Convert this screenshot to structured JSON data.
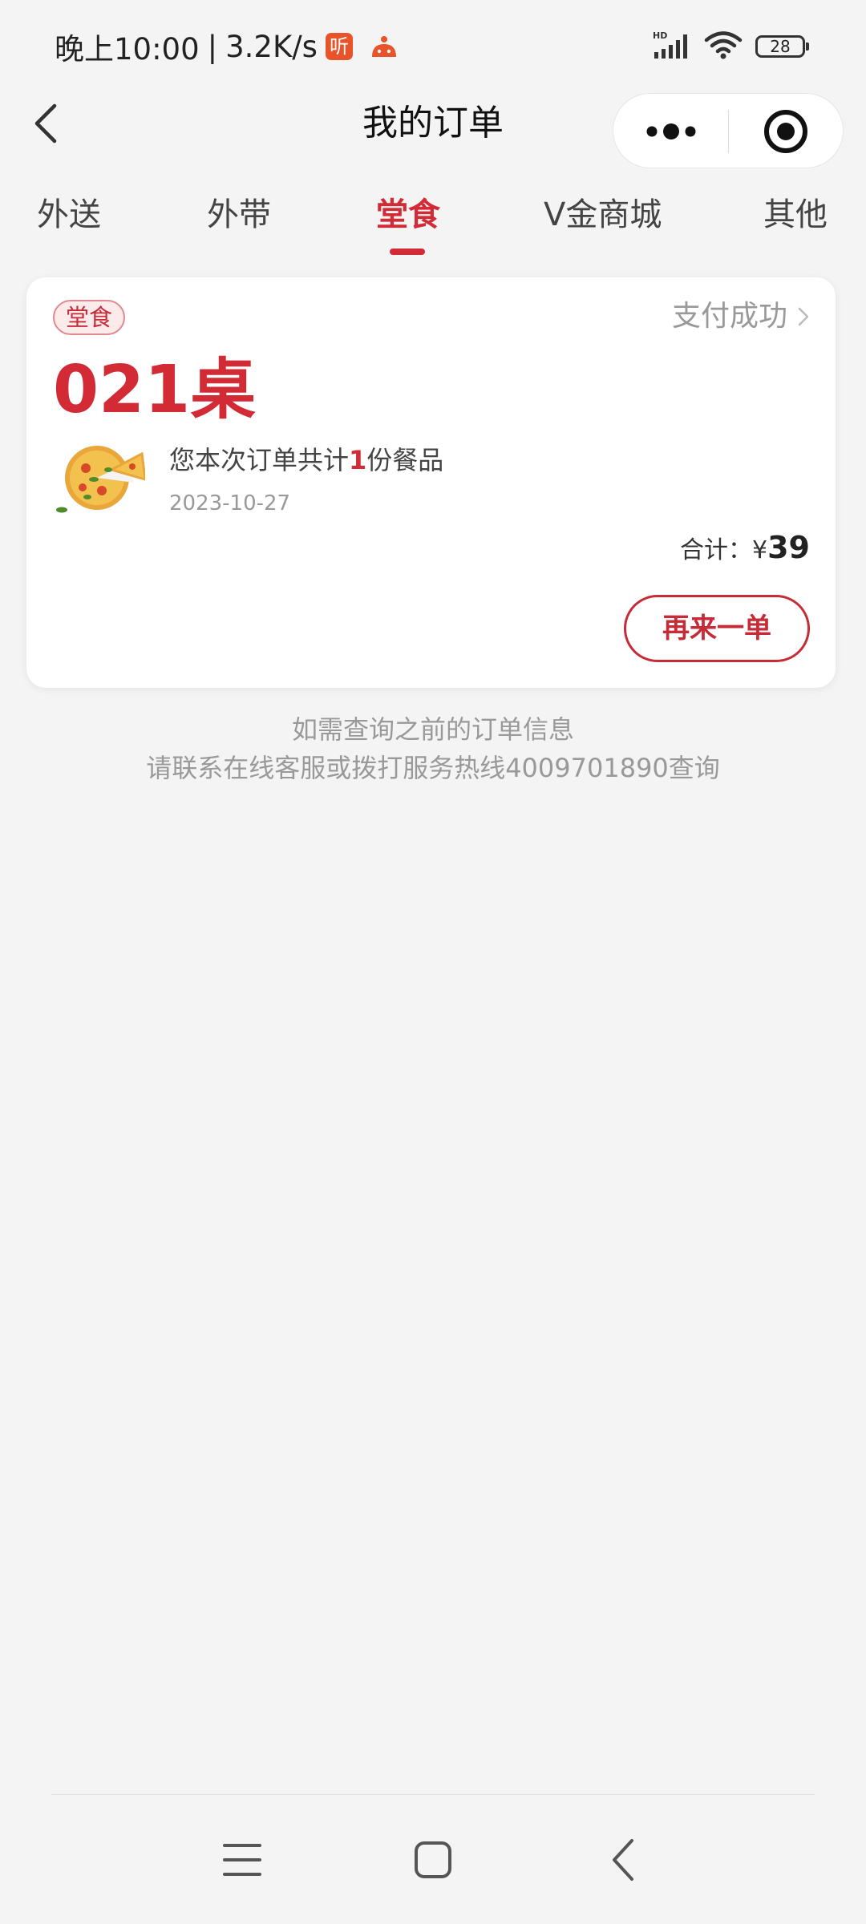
{
  "status_bar": {
    "time": "晚上10:00",
    "separator": "|",
    "network_speed": "3.2K/s",
    "app_icon_1": "ting-app-icon",
    "app_icon_1_glyph": "听",
    "app_icon_2": "app-notification-icon",
    "network_label": "HD",
    "battery_level": "28"
  },
  "nav": {
    "title": "我的订单",
    "back_icon": "chevron-left-icon",
    "more_icon": "more-dots-icon",
    "close_icon": "target-close-icon"
  },
  "tabs": [
    {
      "label": "外送",
      "active": false
    },
    {
      "label": "外带",
      "active": false
    },
    {
      "label": "堂食",
      "active": true
    },
    {
      "label": "V金商城",
      "active": false
    },
    {
      "label": "其他",
      "active": false
    }
  ],
  "order": {
    "type_badge": "堂食",
    "status": "支付成功",
    "table_number": "021桌",
    "summary_prefix": "您本次订单共计",
    "item_count": "1",
    "summary_suffix": "份餐品",
    "date": "2023-10-27",
    "total_label": "合计：",
    "currency": "¥",
    "total_amount": "39",
    "reorder_label": "再来一单"
  },
  "footer": {
    "line1": "如需查询之前的订单信息",
    "line2": "请联系在线客服或拨打服务热线4009701890查询"
  },
  "colors": {
    "accent": "#d22b36",
    "background": "#f4f4f4",
    "card": "#ffffff",
    "muted_text": "#999999"
  }
}
